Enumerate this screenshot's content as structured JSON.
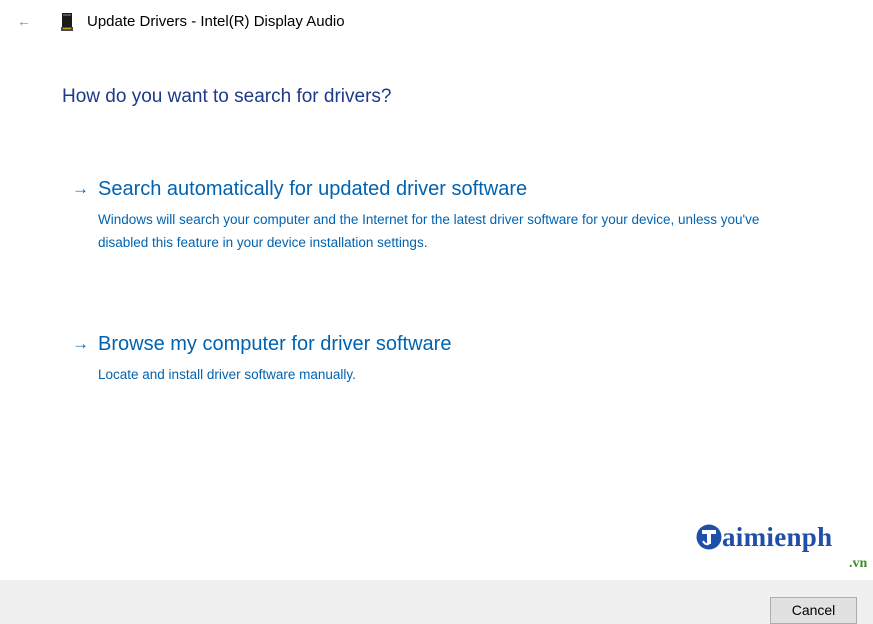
{
  "window": {
    "title": "Update Drivers - Intel(R) Display Audio",
    "back_icon": "←",
    "device_icon": "device-icon"
  },
  "main": {
    "heading": "How do you want to search for drivers?",
    "options": [
      {
        "arrow": "→",
        "title": "Search automatically for updated driver software",
        "description": "Windows will search your computer and the Internet for the latest driver software for your device, unless you've disabled this feature in your device installation settings."
      },
      {
        "arrow": "→",
        "title": "Browse my computer for driver software",
        "description": "Locate and install driver software manually."
      }
    ]
  },
  "watermark": {
    "text": "aimienph",
    "sub": ".vn"
  },
  "footer": {
    "cancel_label": "Cancel"
  },
  "colors": {
    "heading": "#1d3a8a",
    "link": "#0063b1",
    "footer_bg": "#f0f0f0",
    "watermark_blue": "#1f4fa8",
    "watermark_green": "#3d8f24"
  }
}
